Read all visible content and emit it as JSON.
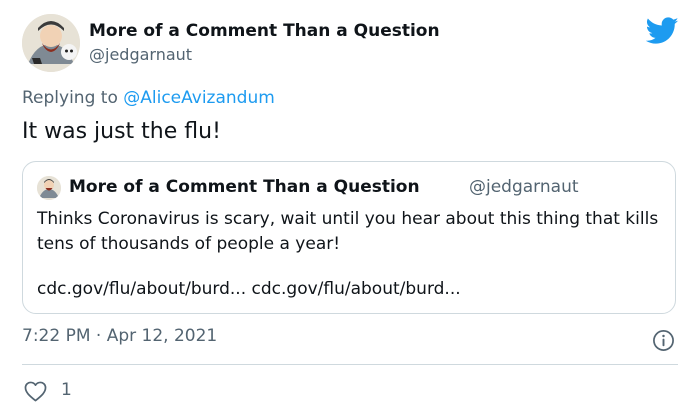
{
  "author": {
    "name": "More of a Comment Than a Question",
    "handle": "@jedgarnaut"
  },
  "reply": {
    "prefix": "Replying to ",
    "to": "@AliceAvizandum"
  },
  "tweet": {
    "text": "It was just the flu!"
  },
  "quote": {
    "name": "More of a Comment Than a Question",
    "handle": "@jedgarnaut",
    "text": "Thinks Coronavirus is scary, wait until you hear about this thing that kills tens of thousands of people a year!",
    "links": "cdc.gov/flu/about/burd... cdc.gov/flu/about/burd..."
  },
  "meta": {
    "timestamp": "7:22 PM · Apr 12, 2021"
  },
  "actions": {
    "like_count": "1"
  },
  "colors": {
    "accent": "#1d9bf0",
    "secondary_text": "#536471",
    "border": "#cfd9de"
  },
  "icons": {
    "brand": "twitter-bird-icon",
    "info": "info-icon",
    "like": "heart-icon"
  }
}
